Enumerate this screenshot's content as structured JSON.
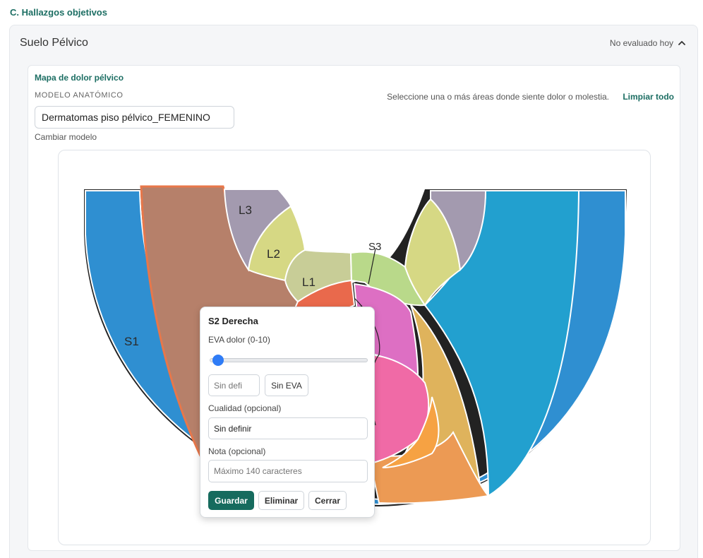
{
  "section_title": "C. Hallazgos objetivos",
  "card": {
    "title": "Suelo Pélvico",
    "status": "No evaluado hoy"
  },
  "map": {
    "title": "Mapa de dolor pélvico",
    "model_label": "MODELO ANATÓMICO",
    "model_value": "Dermatomas piso pélvico_FEMENINO",
    "change_model": "Cambiar modelo",
    "instruction": "Seleccione una o más áreas donde siente dolor o molestia.",
    "clear_all": "Limpiar todo",
    "region_labels": {
      "s1": "S1",
      "l3": "L3",
      "l2": "L2",
      "l1": "L1",
      "s3": "S3"
    },
    "colors": {
      "s1_blue": "#2f8fd1",
      "s2_selected": "#b6806a",
      "l3": "#a39aaf",
      "l2": "#d6d884",
      "l1": "#c8cd97",
      "s3": "#b9d98a",
      "cyan": "#22a0cf",
      "red": "#e9694c",
      "magenta": "#dd6fc3",
      "pink": "#f06aa6",
      "gold": "#dfb35c",
      "orange": "#ec9a54"
    }
  },
  "popup": {
    "title": "S2 Derecha",
    "eva_label": "EVA dolor (0-10)",
    "eva_value": 0,
    "eva_placeholder": "Sin defi",
    "sin_eva_button": "Sin EVA",
    "quality_label": "Cualidad (opcional)",
    "quality_value": "Sin definir",
    "note_label": "Nota (opcional)",
    "note_placeholder": "Máximo 140 caracteres",
    "save_button": "Guardar",
    "delete_button": "Eliminar",
    "close_button": "Cerrar"
  }
}
